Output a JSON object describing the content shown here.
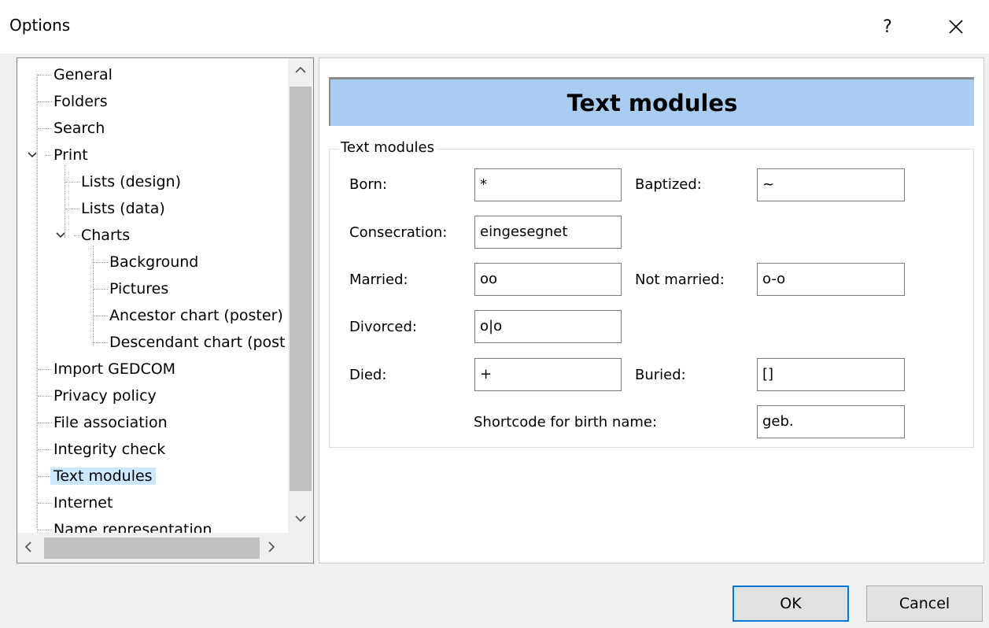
{
  "window": {
    "title": "Options",
    "help_label": "?"
  },
  "tree": {
    "items": [
      {
        "label": "General"
      },
      {
        "label": "Folders"
      },
      {
        "label": "Search"
      },
      {
        "label": "Print"
      },
      {
        "label": "Lists (design)"
      },
      {
        "label": "Lists (data)"
      },
      {
        "label": "Charts"
      },
      {
        "label": "Background"
      },
      {
        "label": "Pictures"
      },
      {
        "label": "Ancestor chart (poster)"
      },
      {
        "label": "Descendant chart (post"
      },
      {
        "label": "Import GEDCOM"
      },
      {
        "label": "Privacy policy"
      },
      {
        "label": "File association"
      },
      {
        "label": "Integrity check"
      },
      {
        "label": "Text modules"
      },
      {
        "label": "Internet"
      },
      {
        "label": "Name representation"
      }
    ],
    "selected": "Text modules"
  },
  "content": {
    "header": "Text modules",
    "group_title": "Text modules",
    "fields": {
      "born": {
        "label": "Born:",
        "value": "*"
      },
      "baptized": {
        "label": "Baptized:",
        "value": "~"
      },
      "consecration": {
        "label": "Consecration:",
        "value": "eingesegnet"
      },
      "married": {
        "label": "Married:",
        "value": "oo"
      },
      "not_married": {
        "label": "Not married:",
        "value": "o-o"
      },
      "divorced": {
        "label": "Divorced:",
        "value": "o|o"
      },
      "died": {
        "label": "Died:",
        "value": "+"
      },
      "buried": {
        "label": "Buried:",
        "value": "[]"
      },
      "shortcode": {
        "label": "Shortcode for birth name:",
        "value": "geb."
      }
    }
  },
  "footer": {
    "ok_label": "OK",
    "cancel_label": "Cancel"
  },
  "colors": {
    "header_band": "#a9cdf0",
    "selection": "#cce8ff",
    "default_button_border": "#0078d7"
  }
}
